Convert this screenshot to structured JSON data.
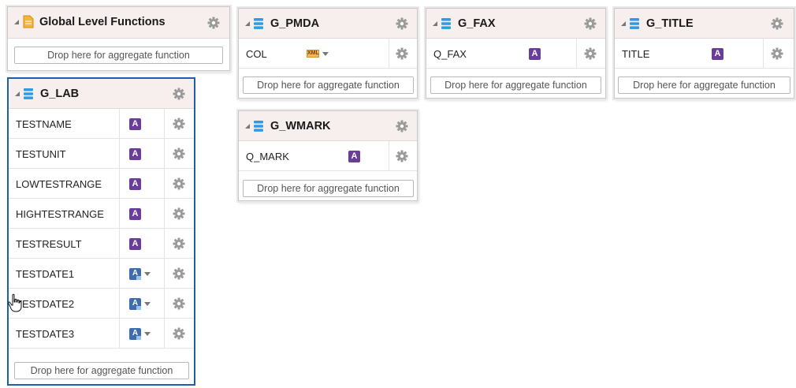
{
  "drop_label": "Drop here for aggregate function",
  "global": {
    "title": "Global Level Functions"
  },
  "g_lab": {
    "title": "G_LAB",
    "rows": [
      {
        "name": "TESTNAME",
        "type": "string"
      },
      {
        "name": "TESTUNIT",
        "type": "string"
      },
      {
        "name": "LOWTESTRANGE",
        "type": "string"
      },
      {
        "name": "HIGHTESTRANGE",
        "type": "string"
      },
      {
        "name": "TESTRESULT",
        "type": "string"
      },
      {
        "name": "TESTDATE1",
        "type": "date"
      },
      {
        "name": "TESTDATE2",
        "type": "date"
      },
      {
        "name": "TESTDATE3",
        "type": "date"
      }
    ]
  },
  "g_pmda": {
    "title": "G_PMDA",
    "rows": [
      {
        "name": "COL",
        "type": "xml"
      }
    ]
  },
  "g_fax": {
    "title": "G_FAX",
    "rows": [
      {
        "name": "Q_FAX",
        "type": "string"
      }
    ]
  },
  "g_title": {
    "title": "G_TITLE",
    "rows": [
      {
        "name": "TITLE",
        "type": "string"
      }
    ]
  },
  "g_wmark": {
    "title": "G_WMARK",
    "rows": [
      {
        "name": "Q_MARK",
        "type": "string"
      }
    ]
  },
  "icons": {
    "gear": "gear-icon",
    "group": "database-icon",
    "global": "document-icon",
    "string_type": "string-type-icon",
    "date_type": "date-type-icon",
    "xml_type": "xml-type-icon"
  },
  "badge_letter": "A",
  "xml_label": "XML",
  "colors": {
    "header_bg": "#f7eeee",
    "selected_border": "#1d5fa8",
    "string_badge": "#6b3d9a",
    "date_badge": "#3e6cae",
    "db_icon": "#2e9be6"
  }
}
